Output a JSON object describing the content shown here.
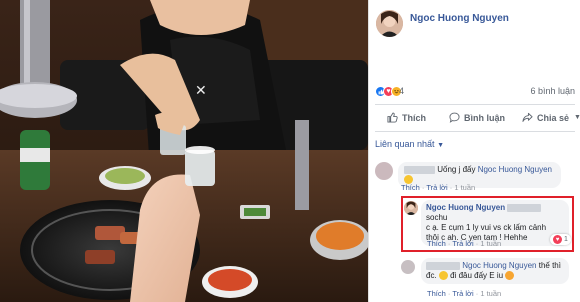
{
  "post": {
    "author": "Ngoc Huong Nguyen",
    "reaction_count": "4",
    "comment_count": "6 bình luận"
  },
  "actions": {
    "like": "Thích",
    "comment": "Bình luận",
    "share": "Chia sẻ"
  },
  "sort": {
    "label": "Liên quan nhất",
    "caret": "▼"
  },
  "comments": [
    {
      "text_before": "Uống j đấy ",
      "tag": "Ngoc Huong Nguyen",
      "like": "Thích",
      "reply": "Trả lời",
      "time": "1 tuần"
    },
    {
      "name": "Ngoc Huong Nguyen",
      "line1_suffix": "sochu",
      "line2": "c ạ. E cụm 1 ly vui vs ck lấm cảnh",
      "line3": "thôi c ah. C yen tam ! Hehhe",
      "like": "Thích",
      "reply": "Trả lời",
      "time": "1 tuần",
      "likes": "1"
    },
    {
      "tag": "Ngoc Huong Nguyen",
      "suffix": " thế thì",
      "line2": "đc. ",
      "line2_b": " đi đâu đấy E iu",
      "like": "Thích",
      "reply": "Trả lời",
      "time": "1 tuần"
    }
  ],
  "separator": "·",
  "colors": {
    "link": "#385898",
    "highlight": "#e0202a",
    "like_blue": "#1877f2"
  }
}
